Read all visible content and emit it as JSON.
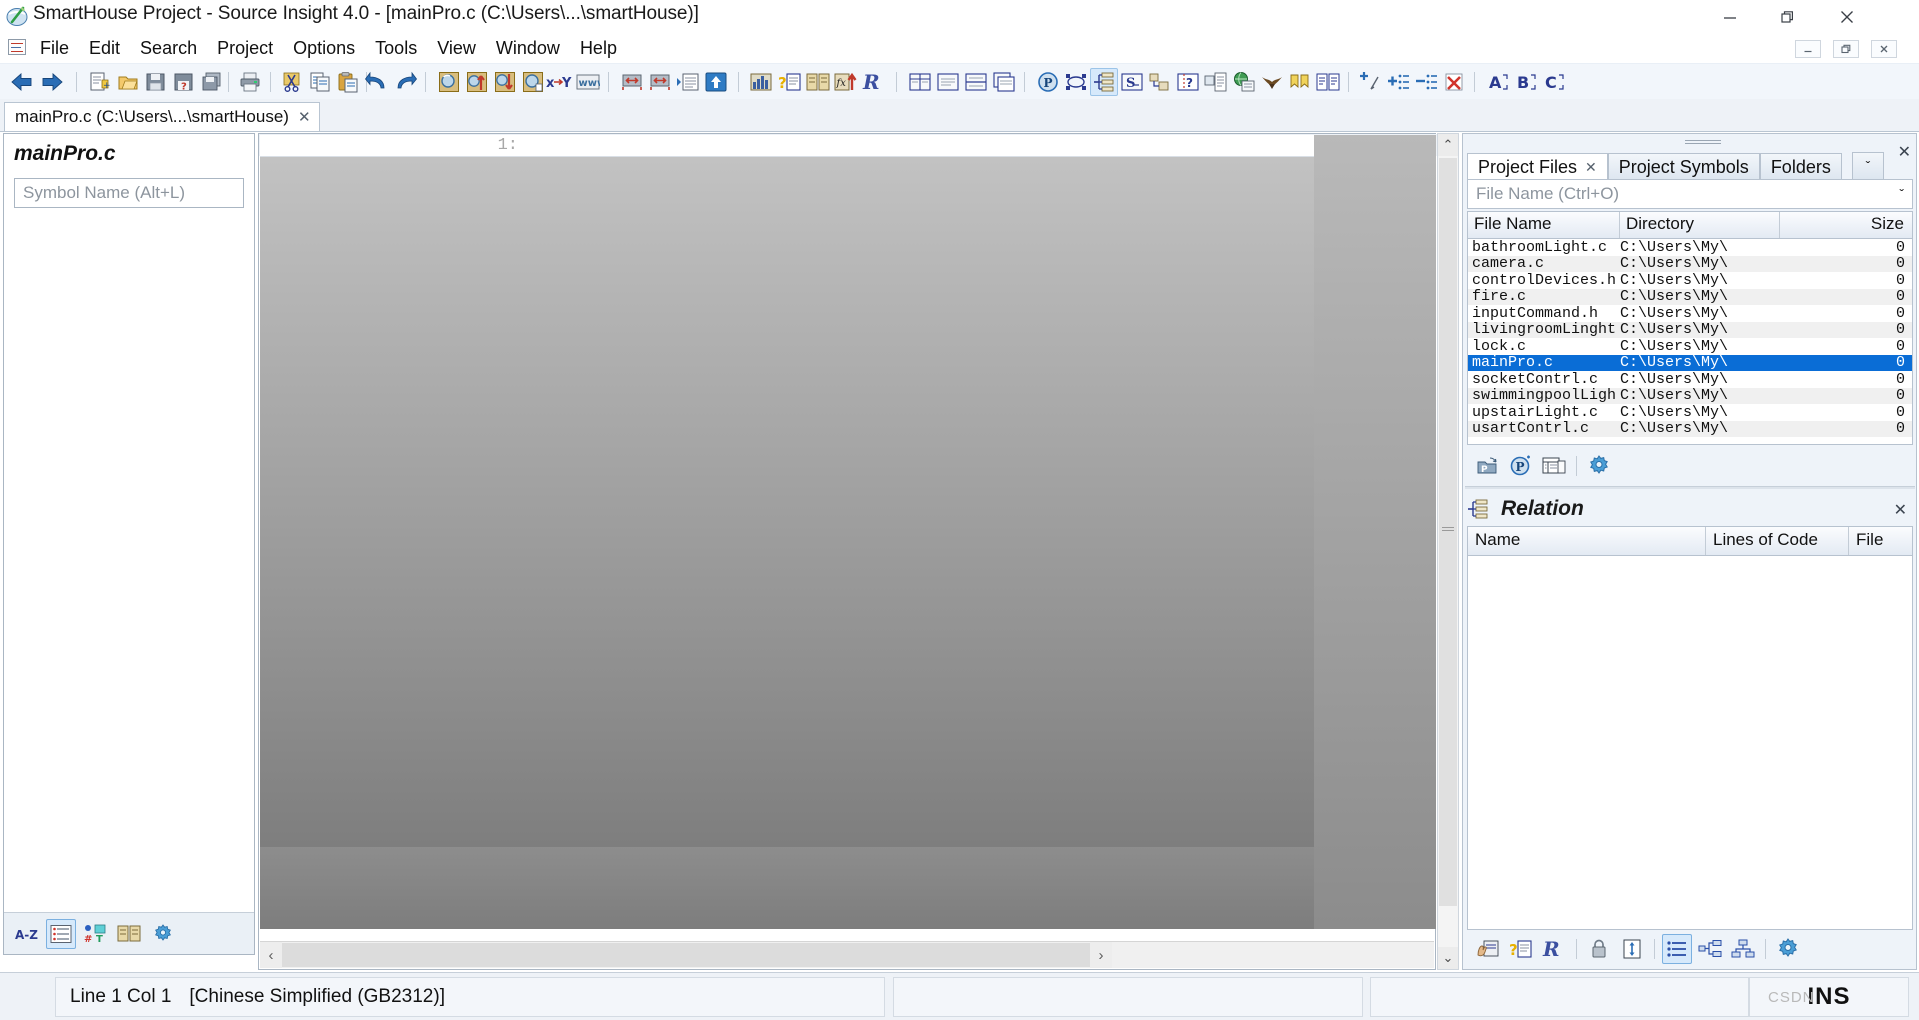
{
  "window": {
    "title": "SmartHouse Project - Source Insight 4.0 - [mainPro.c (C:\\Users\\...\\smartHouse)]",
    "app_icon": "source-insight-logo-icon",
    "minimize": "—",
    "maximize": "❐",
    "close": "✕",
    "mdi_minimize": "–",
    "mdi_restore": "❐",
    "mdi_close": "✕"
  },
  "menu": {
    "items": [
      {
        "label": "File"
      },
      {
        "label": "Edit"
      },
      {
        "label": "Search"
      },
      {
        "label": "Project"
      },
      {
        "label": "Options"
      },
      {
        "label": "Tools"
      },
      {
        "label": "View"
      },
      {
        "label": "Window"
      },
      {
        "label": "Help"
      }
    ]
  },
  "toolbar": {
    "groups": [
      {
        "buttons": [
          {
            "name": "back-icon",
            "glyph": "⬅"
          },
          {
            "name": "forward-icon",
            "glyph": "➡"
          }
        ]
      },
      {
        "buttons": [
          {
            "name": "new-file-icon",
            "glyph": "🗎"
          },
          {
            "name": "open-file-icon",
            "glyph": "📂"
          },
          {
            "name": "save-file-icon",
            "glyph": "💾"
          },
          {
            "name": "save-as-icon",
            "glyph": "💾"
          },
          {
            "name": "save-all-icon",
            "glyph": "🗂"
          }
        ]
      },
      {
        "buttons": [
          {
            "name": "print-icon",
            "glyph": "🖨"
          }
        ]
      },
      {
        "buttons": [
          {
            "name": "cut-icon",
            "glyph": "✂"
          },
          {
            "name": "copy-icon",
            "glyph": "⧉"
          },
          {
            "name": "paste-icon",
            "glyph": "📋"
          }
        ]
      },
      {
        "buttons": [
          {
            "name": "undo-icon",
            "glyph": "↶"
          },
          {
            "name": "redo-icon",
            "glyph": "↷"
          }
        ]
      },
      {
        "buttons": [
          {
            "name": "search-icon",
            "glyph": "🔍"
          },
          {
            "name": "search-backward-icon",
            "glyph": "🔎"
          },
          {
            "name": "search-forward-icon",
            "glyph": "🔎"
          },
          {
            "name": "search-files-icon",
            "glyph": "🔍"
          },
          {
            "name": "replace-icon",
            "glyph": "x→y"
          },
          {
            "name": "web-search-icon",
            "glyph": "www"
          }
        ]
      },
      {
        "buttons": [
          {
            "name": "jump-back-icon",
            "glyph": "↔"
          },
          {
            "name": "jump-forward-icon",
            "glyph": "↔"
          },
          {
            "name": "jump-to-definition-icon",
            "glyph": "▸≡"
          },
          {
            "name": "jump-to-caller-icon",
            "glyph": "⬆"
          }
        ]
      },
      {
        "buttons": [
          {
            "name": "browse-project-symbols-icon",
            "glyph": "📊"
          },
          {
            "name": "context-help-icon",
            "glyph": "?≡"
          },
          {
            "name": "reference-book-icon",
            "glyph": "📖"
          },
          {
            "name": "function-up-icon",
            "glyph": "fn⬆"
          },
          {
            "name": "smart-rename-icon",
            "glyph": "ℛ"
          }
        ]
      },
      {
        "buttons": [
          {
            "name": "split-window-icon",
            "glyph": "⊞"
          },
          {
            "name": "single-window-icon",
            "glyph": "☰"
          },
          {
            "name": "horizontal-split-icon",
            "glyph": "≣"
          },
          {
            "name": "duplicate-window-icon",
            "glyph": "⧉"
          }
        ]
      },
      {
        "buttons": [
          {
            "name": "paragraph-marks-icon",
            "glyph": "Ⓟ",
            "active": false
          },
          {
            "name": "toggle-symbol-window-icon",
            "glyph": "⛶",
            "active": false
          },
          {
            "name": "toggle-contexts-icon",
            "glyph": "≡",
            "active": true
          },
          {
            "name": "symbol-info-icon",
            "glyph": "S≡"
          },
          {
            "name": "indent-icon",
            "glyph": "⇥"
          },
          {
            "name": "conditional-parse-icon",
            "glyph": "⁇"
          },
          {
            "name": "comment-block-icon",
            "glyph": "⊟"
          },
          {
            "name": "globe-icon",
            "glyph": "🌐"
          },
          {
            "name": "eagle-icon",
            "glyph": "🦅"
          },
          {
            "name": "bookmarks-icon",
            "glyph": "⚑⚑"
          },
          {
            "name": "compare-files-icon",
            "glyph": "☷"
          }
        ]
      },
      {
        "buttons": [
          {
            "name": "add-bookmark-icon",
            "glyph": "+⸭"
          },
          {
            "name": "expand-all-icon",
            "glyph": "✚≡"
          },
          {
            "name": "collapse-all-icon",
            "glyph": "➖≡"
          },
          {
            "name": "clear-bookmarks-icon",
            "glyph": "✕"
          }
        ]
      },
      {
        "buttons": [
          {
            "name": "font-a-icon",
            "glyph": "A"
          },
          {
            "name": "font-b-icon",
            "glyph": "B"
          },
          {
            "name": "font-c-icon",
            "glyph": "C"
          }
        ]
      }
    ]
  },
  "document_tabs": [
    {
      "label": "mainPro.c (C:\\Users\\...\\smartHouse)",
      "close": "✕",
      "selected": true
    }
  ],
  "symbol_panel": {
    "title": "mainPro.c",
    "search_placeholder": "Symbol Name (Alt+L)",
    "search_value": "",
    "tools": [
      {
        "name": "sort-alphabetical-icon",
        "glyph": "A-Z",
        "active": false
      },
      {
        "name": "symbol-outline-icon",
        "glyph": "≣",
        "active": true
      },
      {
        "name": "symbol-types-icon",
        "glyph": "∴",
        "active": false
      },
      {
        "name": "reference-book-icon",
        "glyph": "📖",
        "active": false
      },
      {
        "name": "symbol-options-gear-icon",
        "glyph": "⚙",
        "active": false
      }
    ]
  },
  "editor": {
    "first_line_number": "1:",
    "scroll_left_arrow": "‹",
    "scroll_right_arrow": "›",
    "scroll_up_arrow": "⌃",
    "scroll_down_arrow": "⌄"
  },
  "right_dock": {
    "close": "✕",
    "tabs": [
      {
        "label": "Project Files",
        "close": "✕",
        "selected": true
      },
      {
        "label": "Project Symbols",
        "selected": false
      },
      {
        "label": "Folders",
        "selected": false
      }
    ],
    "tabs_overflow": "ˇ",
    "filter": {
      "placeholder": "File Name (Ctrl+O)",
      "value": "",
      "chevron": "ˇ"
    },
    "file_table": {
      "columns": [
        "File Name",
        "Directory",
        "Size"
      ],
      "rows": [
        {
          "name": "bathroomLight.c",
          "dir": "C:\\Users\\My\\",
          "size": "0",
          "selected": false
        },
        {
          "name": "camera.c",
          "dir": "C:\\Users\\My\\",
          "size": "0",
          "selected": false
        },
        {
          "name": "controlDevices.h",
          "dir": "C:\\Users\\My\\",
          "size": "0",
          "selected": false
        },
        {
          "name": "fire.c",
          "dir": "C:\\Users\\My\\",
          "size": "0",
          "selected": false
        },
        {
          "name": "inputCommand.h",
          "dir": "C:\\Users\\My\\",
          "size": "0",
          "selected": false
        },
        {
          "name": "livingroomLinght",
          "dir": "C:\\Users\\My\\",
          "size": "0",
          "selected": false
        },
        {
          "name": "lock.c",
          "dir": "C:\\Users\\My\\",
          "size": "0",
          "selected": false
        },
        {
          "name": "mainPro.c",
          "dir": "C:\\Users\\My\\",
          "size": "0",
          "selected": true
        },
        {
          "name": "socketContrl.c",
          "dir": "C:\\Users\\My\\",
          "size": "0",
          "selected": false
        },
        {
          "name": "swimmingpoolLigh",
          "dir": "C:\\Users\\My\\",
          "size": "0",
          "selected": false
        },
        {
          "name": "upstairLight.c",
          "dir": "C:\\Users\\My\\",
          "size": "0",
          "selected": false
        },
        {
          "name": "usartContrl.c",
          "dir": "C:\\Users\\My\\",
          "size": "0",
          "selected": false
        }
      ]
    },
    "file_tools": [
      {
        "name": "add-file-to-project-icon",
        "glyph": "📁"
      },
      {
        "name": "synchronize-project-icon",
        "glyph": "Ⓟ"
      },
      {
        "name": "project-report-icon",
        "glyph": "☷"
      },
      {
        "name": "project-settings-gear-icon",
        "glyph": "⚙"
      }
    ],
    "relation": {
      "icon": "relation-tree-icon",
      "title": "Relation",
      "close": "✕",
      "columns": [
        "Name",
        "Lines of Code",
        "File"
      ],
      "rows": [],
      "tools": [
        {
          "name": "relation-hand-icon",
          "glyph": "✋"
        },
        {
          "name": "relation-help-icon",
          "glyph": "?≡"
        },
        {
          "name": "relation-rename-icon",
          "glyph": "ℛ"
        },
        {
          "name": "relation-lock-icon",
          "glyph": "🔒"
        },
        {
          "name": "relation-refresh-icon",
          "glyph": "⇅"
        },
        {
          "name": "relation-outline-view-icon",
          "glyph": "≣",
          "active": true
        },
        {
          "name": "relation-horizontal-graph-icon",
          "glyph": "⊸"
        },
        {
          "name": "relation-vertical-graph-icon",
          "glyph": "⑂"
        },
        {
          "name": "relation-settings-gear-icon",
          "glyph": "⚙"
        }
      ]
    }
  },
  "status_bar": {
    "line_col": "Line 1  Col 1",
    "encoding": "[Chinese Simplified (GB2312)]",
    "insert_mode": "INS",
    "watermark": "CSDN"
  },
  "colors": {
    "accent": "#0a6dd6",
    "toolbar_bg": "#f2f6fb",
    "dock_bg": "#eef3f9",
    "editor_gradient_top": "#c2c2c2",
    "editor_gradient_bottom": "#7e7e7e"
  }
}
